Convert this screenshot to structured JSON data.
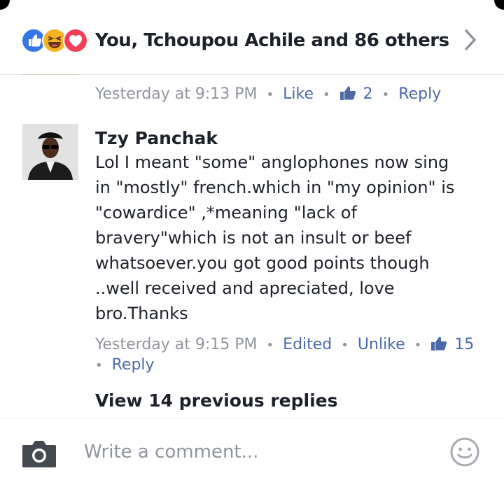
{
  "header": {
    "reaction_icons": [
      "like-icon",
      "haha-icon",
      "love-icon"
    ],
    "summary": "You, Tchoupou Achile and 86 others",
    "chevron_icon": "chevron-right-icon"
  },
  "previous_comment": {
    "timestamp": "Yesterday at 9:13 PM",
    "like_label": "Like",
    "like_count": "2",
    "reply_label": "Reply"
  },
  "comment": {
    "author": "Tzy Panchak",
    "body_lines": [
      "Lol I meant \"some\" anglophones now sing",
      "in \"mostly\" french.which in \"my opinion\" is",
      "\"cowardice\" ,*meaning \"lack of",
      "bravery\"which is not an insult or beef",
      "whatsoever.you got good points though",
      "..well received and apreciated, love",
      "bro.Thanks"
    ],
    "timestamp": "Yesterday at 9:15 PM",
    "edited_label": "Edited",
    "unlike_label": "Unlike",
    "like_count": "15",
    "reply_label": "Reply"
  },
  "view_previous_replies": "View 14 previous replies",
  "composer": {
    "placeholder": "Write a comment...",
    "camera_icon": "camera-icon",
    "emoji_icon": "smiley-icon"
  },
  "colors": {
    "link": "#4b6aa8",
    "meta_gray": "#90949c",
    "text": "#1d2129",
    "like_blue": "#3578e5",
    "love_red": "#f33e58",
    "haha_yellow": "#f7b125"
  }
}
